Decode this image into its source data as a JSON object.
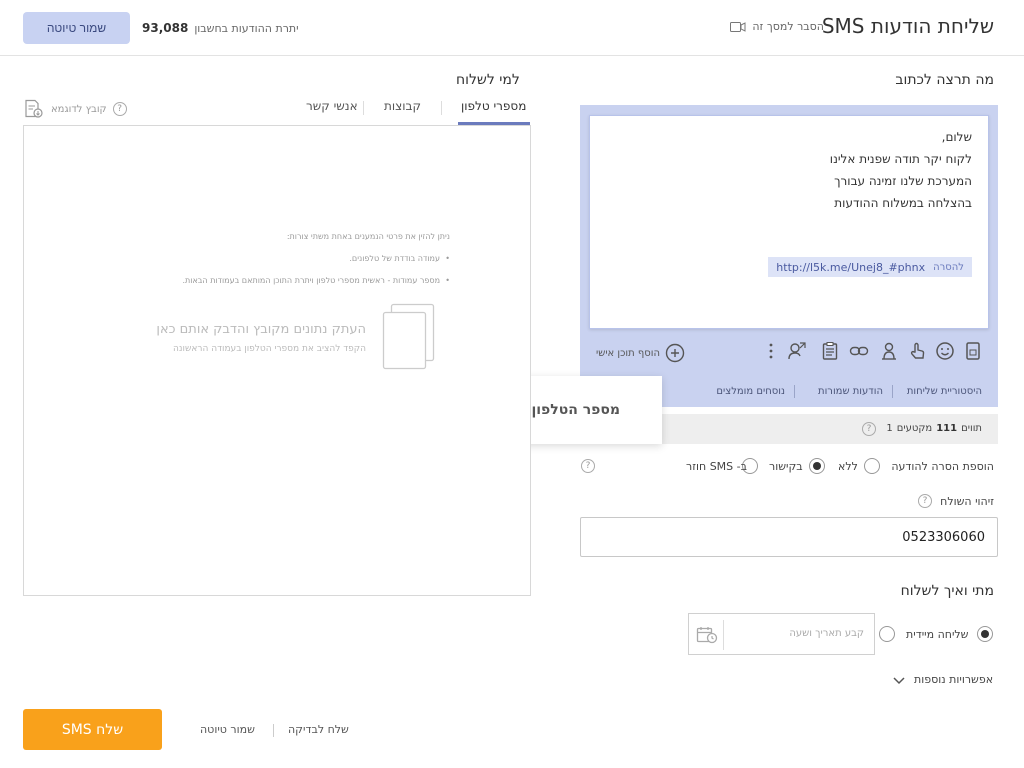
{
  "header": {
    "title": "שליחת הודעות SMS",
    "explain_label": "הסבר למסך זה",
    "balance_label": "יתרת ההודעות בחשבון",
    "balance_value": "93,088",
    "save_draft_label": "שמור טיוטה"
  },
  "compose": {
    "section_title": "מה תרצה לכתוב",
    "message_lines": [
      "שלום,",
      "לקוח יקר תודה שפנית אלינו",
      "המערכת שלנו זמינה עבורך",
      "בהצלחה במשלוח ההודעות"
    ],
    "link_url": "http://l5k.me/Unej8_#phnx",
    "link_remove_label": "להסרה",
    "add_personal_label": "הוסף תוכן אישי",
    "toolbar_icons": [
      "sim-card-icon",
      "emoji-icon",
      "hand-pointer-icon",
      "person-pin-icon",
      "link-icon",
      "form-clipboard-icon",
      "person-badge-icon",
      "more-vertical-icon"
    ],
    "links": [
      "היסטוריית שליחות",
      "הודעות שמורות",
      "נוסחים מומלצים"
    ],
    "counter": {
      "chars_label": "תווים",
      "chars_value": "111",
      "segments_label": "מקטעים",
      "segments_value": "1"
    },
    "unsubscribe": {
      "label": "הוספת הסרה להודעה",
      "options": [
        "ללא",
        "בקישור",
        "ב- SMS חוזר"
      ],
      "selected": "בקישור"
    },
    "sender": {
      "label": "זיהוי השולח",
      "value": "0523306060"
    }
  },
  "toast": {
    "message": "מספר הטלפון אומת בהצלחה"
  },
  "schedule": {
    "section_title": "מתי ואיך לשלוח",
    "immediate_label": "שליחה מיידית",
    "date_placeholder": "קבע תאריך ושעה",
    "more_options_label": "אפשרויות נוספות"
  },
  "recipients": {
    "section_title": "למי לשלוח",
    "tabs": [
      "מספרי טלפון",
      "קבוצות",
      "אנשי קשר"
    ],
    "active_tab": "מספרי טלפון",
    "sample_file_label": "קובץ לדוגמא",
    "instructions_title": "ניתן להזין את פרטי הנמענים באחת משתי צורות:",
    "instructions_items": [
      "עמודה בודדת של טלפונים.",
      "מספר עמודות - ראשית מספרי טלפון ויתרת התוכן המותאם בעמודות הבאות."
    ],
    "drop_title": "העתק נתונים מקובץ והדבק אותם כאן",
    "drop_subtitle": "הקפד להציב את מספרי הטלפון בעמודה הראשונה"
  },
  "footer": {
    "send_label": "שלח SMS",
    "save_draft_label": "שמור טיוטה",
    "test_send_label": "שלח לבדיקה"
  },
  "colors": {
    "accent": "#f9a11b",
    "panel": "#c9d2f0",
    "active_tab_underline": "#6b7bbd"
  }
}
